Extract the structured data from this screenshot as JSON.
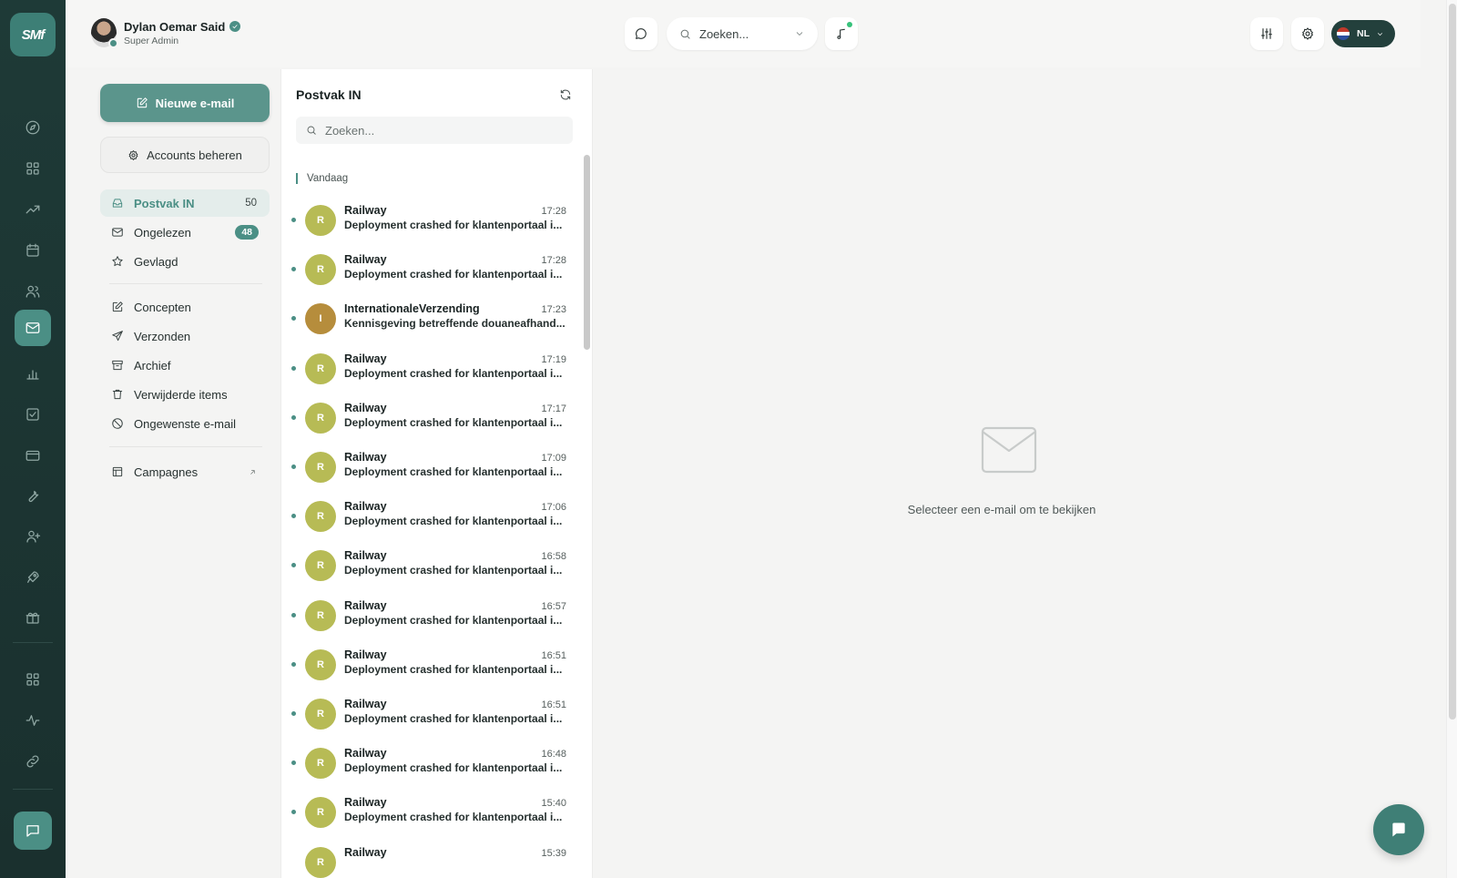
{
  "app": {
    "logo_text": "SMf",
    "accent": "#4b8f85",
    "rail_bg": "#1e3a37"
  },
  "user": {
    "name": "Dylan Oemar Said",
    "role": "Super Admin"
  },
  "topbar": {
    "search_placeholder": "Zoeken...",
    "language": "NL"
  },
  "folders_panel": {
    "compose_label": "Nieuwe e-mail",
    "accounts_label": "Accounts beheren",
    "items": [
      {
        "label": "Postvak IN",
        "icon": "inbox-icon",
        "count": "50",
        "active": true
      },
      {
        "label": "Ongelezen",
        "icon": "mail-icon",
        "badge": "48"
      },
      {
        "label": "Gevlagd",
        "icon": "star-icon"
      },
      {
        "label": "Concepten",
        "icon": "edit-icon"
      },
      {
        "label": "Verzonden",
        "icon": "send-icon"
      },
      {
        "label": "Archief",
        "icon": "archive-icon"
      },
      {
        "label": "Verwijderde items",
        "icon": "trash-icon"
      },
      {
        "label": "Ongewenste e-mail",
        "icon": "block-icon"
      },
      {
        "label": "Campagnes",
        "icon": "layout-icon",
        "external": true
      }
    ]
  },
  "list": {
    "title": "Postvak IN",
    "search_placeholder": "Zoeken...",
    "group_label": "Vandaag",
    "emails": [
      {
        "sender": "Railway",
        "initial": "R",
        "time": "17:28",
        "subject": "Deployment crashed for klantenportaal i...",
        "avatar_color": "#b7bb55",
        "unread": true
      },
      {
        "sender": "Railway",
        "initial": "R",
        "time": "17:28",
        "subject": "Deployment crashed for klantenportaal i...",
        "avatar_color": "#b7bb55",
        "unread": true
      },
      {
        "sender": "InternationaleVerzending",
        "initial": "I",
        "time": "17:23",
        "subject": "Kennisgeving betreffende douaneafhand...",
        "avatar_color": "#b68d3c",
        "unread": true
      },
      {
        "sender": "Railway",
        "initial": "R",
        "time": "17:19",
        "subject": "Deployment crashed for klantenportaal i...",
        "avatar_color": "#b7bb55",
        "unread": true
      },
      {
        "sender": "Railway",
        "initial": "R",
        "time": "17:17",
        "subject": "Deployment crashed for klantenportaal i...",
        "avatar_color": "#b7bb55",
        "unread": true
      },
      {
        "sender": "Railway",
        "initial": "R",
        "time": "17:09",
        "subject": "Deployment crashed for klantenportaal i...",
        "avatar_color": "#b7bb55",
        "unread": true
      },
      {
        "sender": "Railway",
        "initial": "R",
        "time": "17:06",
        "subject": "Deployment crashed for klantenportaal i...",
        "avatar_color": "#b7bb55",
        "unread": true
      },
      {
        "sender": "Railway",
        "initial": "R",
        "time": "16:58",
        "subject": "Deployment crashed for klantenportaal i...",
        "avatar_color": "#b7bb55",
        "unread": true
      },
      {
        "sender": "Railway",
        "initial": "R",
        "time": "16:57",
        "subject": "Deployment crashed for klantenportaal i...",
        "avatar_color": "#b7bb55",
        "unread": true
      },
      {
        "sender": "Railway",
        "initial": "R",
        "time": "16:51",
        "subject": "Deployment crashed for klantenportaal i...",
        "avatar_color": "#b7bb55",
        "unread": true
      },
      {
        "sender": "Railway",
        "initial": "R",
        "time": "16:51",
        "subject": "Deployment crashed for klantenportaal i...",
        "avatar_color": "#b7bb55",
        "unread": true
      },
      {
        "sender": "Railway",
        "initial": "R",
        "time": "16:48",
        "subject": "Deployment crashed for klantenportaal i...",
        "avatar_color": "#b7bb55",
        "unread": true
      },
      {
        "sender": "Railway",
        "initial": "R",
        "time": "15:40",
        "subject": "Deployment crashed for klantenportaal i...",
        "avatar_color": "#b7bb55",
        "unread": true
      },
      {
        "sender": "Railway",
        "initial": "R",
        "time": "15:39",
        "subject": "",
        "avatar_color": "#b7bb55",
        "unread": false
      }
    ]
  },
  "reading_pane": {
    "empty_text": "Selecteer een e-mail om te bekijken"
  }
}
